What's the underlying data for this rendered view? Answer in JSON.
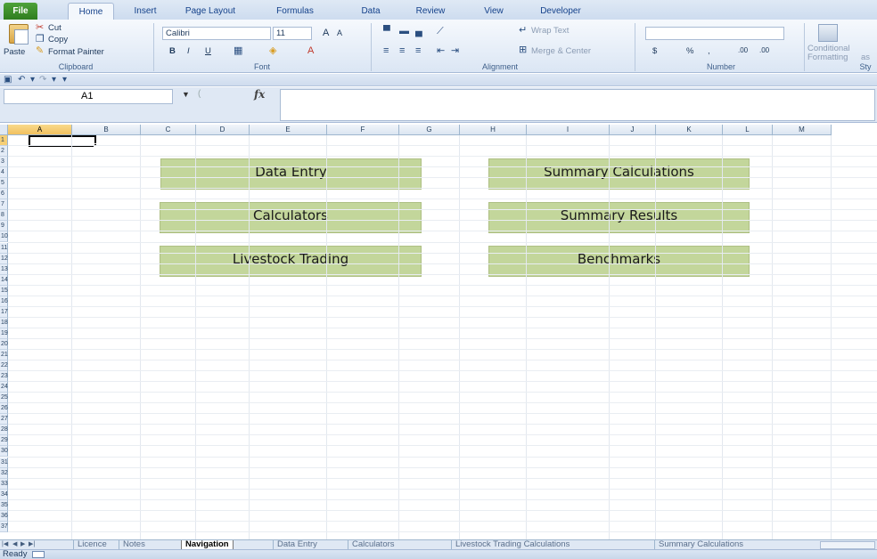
{
  "ribbon_tabs": [
    "File",
    "Home",
    "Insert",
    "Page Layout",
    "Formulas",
    "Data",
    "Review",
    "View",
    "Developer"
  ],
  "clipboard": {
    "paste": "Paste",
    "cut": "Cut",
    "copy": "Copy",
    "format_painter": "Format Painter",
    "label": "Clipboard"
  },
  "font": {
    "name": "Calibri",
    "size": "11",
    "label": "Font",
    "bold": "B",
    "italic": "I",
    "underline": "U",
    "grow": "A",
    "shrink": "A"
  },
  "alignment": {
    "wrap_text": "Wrap Text",
    "merge_center": "Merge & Center",
    "label": "Alignment"
  },
  "number": {
    "currency": "$",
    "percent": "%",
    "comma": ",",
    "increase_decimal": ".00",
    "decrease_decimal": ".00",
    "label": "Number"
  },
  "styles": {
    "conditional": "Conditional",
    "formatting": "Formatting",
    "as": "as",
    "label": "Sty"
  },
  "formula_bar": {
    "name_box": "A1",
    "fx": "fx",
    "value": ""
  },
  "columns": [
    "A",
    "B",
    "C",
    "D",
    "E",
    "F",
    "G",
    "H",
    "I",
    "J",
    "K",
    "L",
    "M"
  ],
  "rows": [
    "1",
    "2",
    "3",
    "4",
    "5",
    "6",
    "7",
    "8",
    "9",
    "10",
    "11",
    "12",
    "13",
    "14",
    "15",
    "16",
    "17",
    "18",
    "19",
    "20",
    "21",
    "22",
    "23",
    "24",
    "25",
    "26",
    "27",
    "28",
    "29",
    "30",
    "31",
    "32",
    "33",
    "34",
    "35",
    "36",
    "37"
  ],
  "nav_buttons": {
    "data_entry": "Data Entry",
    "calculators": "Calculators",
    "livestock_trading": "Livestock Trading",
    "summary_calculations": "Summary Calculations",
    "summary_results": "Summary Results",
    "benchmarks": "Benchmarks"
  },
  "sheet_tabs": [
    "Licence",
    "Notes",
    "Navigation",
    "Data Entry",
    "Calculators",
    "Livestock Trading Calculations",
    "Summary Calculations"
  ],
  "active_sheet": "Navigation",
  "status": "Ready"
}
